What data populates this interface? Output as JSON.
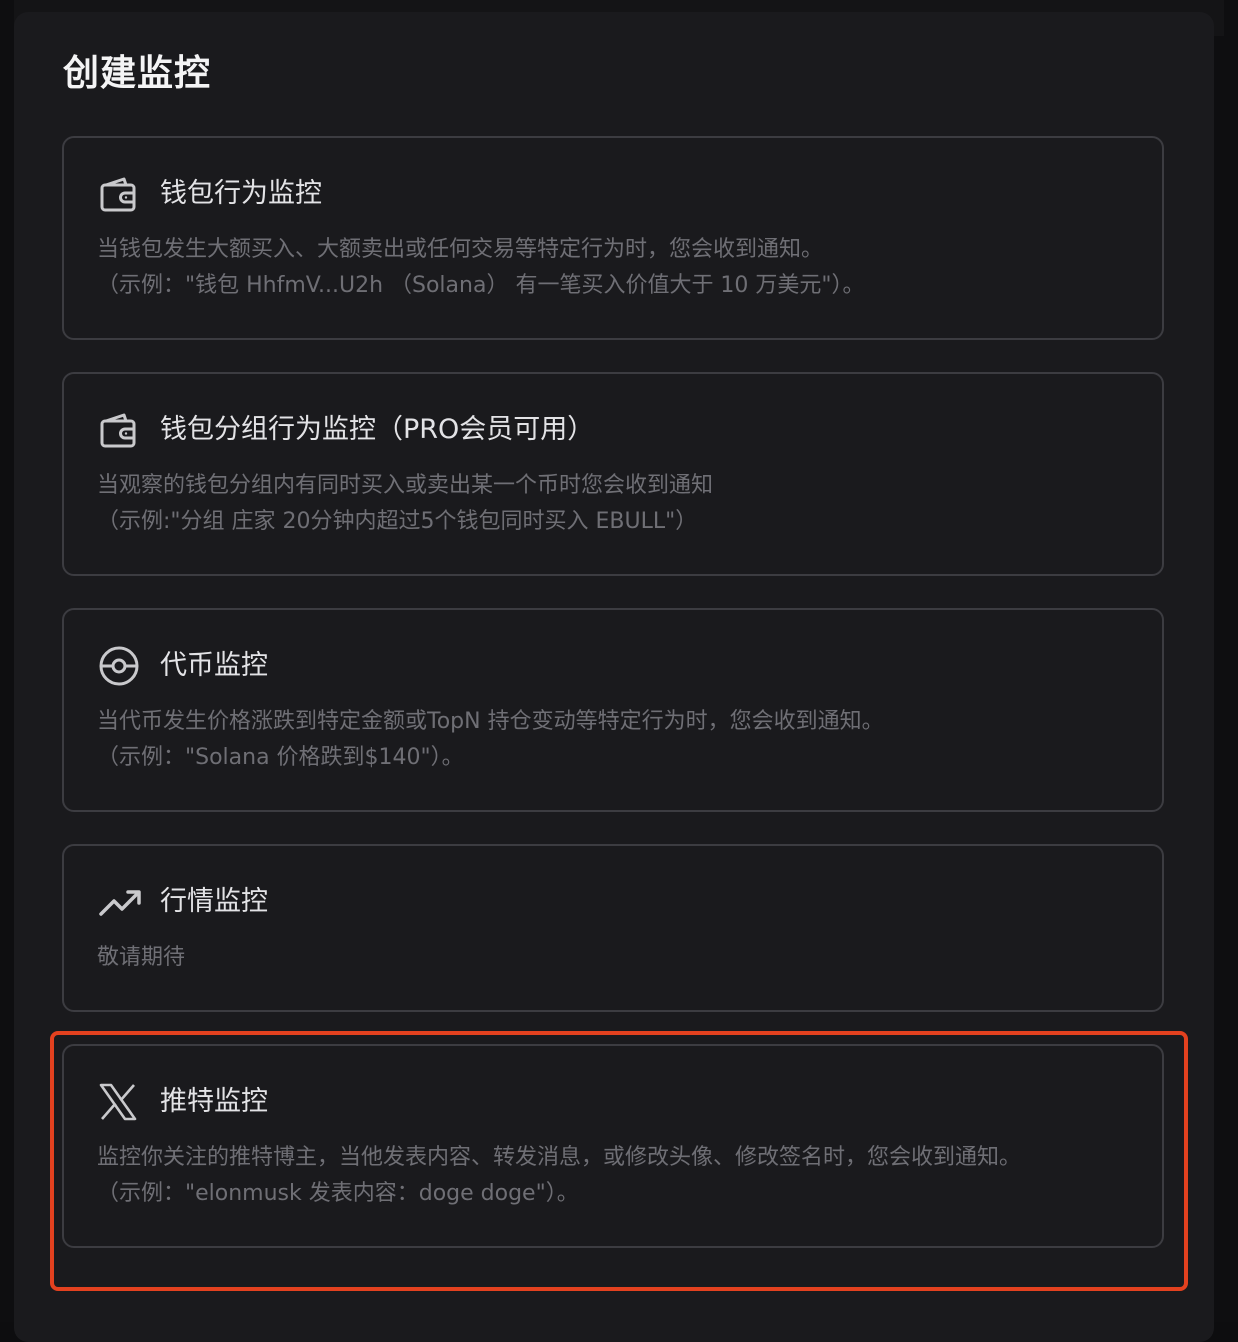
{
  "modal": {
    "title": "创建监控"
  },
  "options": [
    {
      "icon": "wallet-icon",
      "title": "钱包行为监控",
      "desc_line1": "当钱包发生大额买入、大额卖出或任何交易等特定行为时，您会收到通知。",
      "desc_line2": "（示例：\"钱包 HhfmV...U2h （Solana） 有一笔买入价值大于 10 万美元\"）。"
    },
    {
      "icon": "wallet-group-icon",
      "title": "钱包分组行为监控（PRO会员可用）",
      "desc_line1": "当观察的钱包分组内有同时买入或卖出某一个币时您会收到通知",
      "desc_line2": "（示例:\"分组 庄家 20分钟内超过5个钱包同时买入 EBULL\"）"
    },
    {
      "icon": "token-icon",
      "title": "代币监控",
      "desc_line1": "当代币发生价格涨跌到特定金额或TopN 持仓变动等特定行为时，您会收到通知。",
      "desc_line2": "（示例：\"Solana 价格跌到$140\"）。"
    },
    {
      "icon": "trending-up-icon",
      "title": "行情监控",
      "desc_line1": "敬请期待",
      "desc_line2": ""
    },
    {
      "icon": "x-logo-icon",
      "title": "推特监控",
      "desc_line1": "监控你关注的推特博主，当他发表内容、转发消息，或修改头像、修改签名时，您会收到通知。",
      "desc_line2": "（示例：\"elonmusk 发表内容：doge doge\"）。"
    }
  ],
  "colors": {
    "modal_bg": "#1a1a1d",
    "card_border": "#3c3c41",
    "title_text": "#f4f4f5",
    "desc_text": "#6f6f75",
    "highlight": "#e3411f"
  }
}
